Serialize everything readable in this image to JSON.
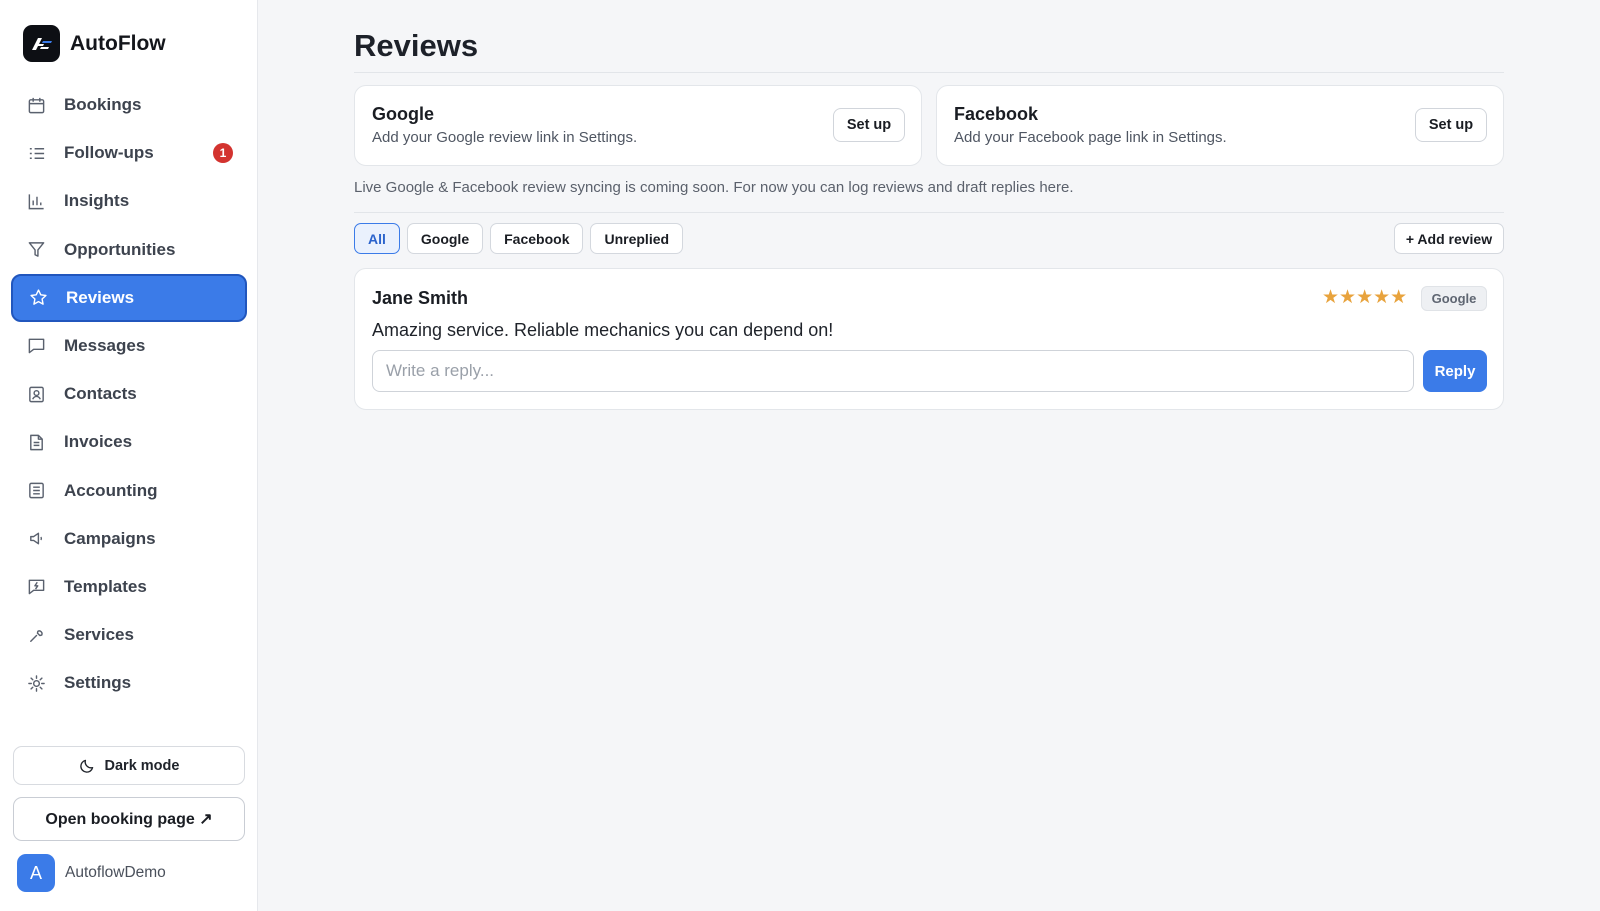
{
  "app": {
    "name": "AutoFlow",
    "logo_text": "AF"
  },
  "sidebar": {
    "items": [
      {
        "label": "Bookings",
        "icon": "calendar-icon"
      },
      {
        "label": "Follow-ups",
        "icon": "list-icon",
        "badge": "1"
      },
      {
        "label": "Insights",
        "icon": "bar-chart-icon"
      },
      {
        "label": "Opportunities",
        "icon": "filter-icon"
      },
      {
        "label": "Reviews",
        "icon": "star-icon",
        "active": true
      },
      {
        "label": "Messages",
        "icon": "message-icon"
      },
      {
        "label": "Contacts",
        "icon": "contact-icon"
      },
      {
        "label": "Invoices",
        "icon": "document-icon"
      },
      {
        "label": "Accounting",
        "icon": "ledger-icon"
      },
      {
        "label": "Campaigns",
        "icon": "megaphone-icon"
      },
      {
        "label": "Templates",
        "icon": "template-icon"
      },
      {
        "label": "Services",
        "icon": "wrench-icon"
      },
      {
        "label": "Settings",
        "icon": "gear-icon"
      }
    ],
    "dark_mode_label": "Dark mode",
    "booking_page_label": "Open booking page ↗",
    "user": {
      "initial": "A",
      "name": "AutoflowDemo"
    }
  },
  "main": {
    "title": "Reviews",
    "integrations": [
      {
        "name": "Google",
        "description": "Add your Google review link in Settings.",
        "button": "Set up"
      },
      {
        "name": "Facebook",
        "description": "Add your Facebook page link in Settings.",
        "button": "Set up"
      }
    ],
    "info": "Live Google & Facebook review syncing is coming soon. For now you can log reviews and draft replies here.",
    "filters": [
      "All",
      "Google",
      "Facebook",
      "Unreplied"
    ],
    "active_filter": "All",
    "add_review_label": "+ Add review",
    "reviews": [
      {
        "author": "Jane Smith",
        "rating": 5,
        "stars": "★★★★★",
        "source": "Google",
        "text": "Amazing service. Reliable mechanics you can depend on!",
        "reply_placeholder": "Write a reply...",
        "reply_button": "Reply"
      }
    ]
  },
  "colors": {
    "accent": "#3b7be8",
    "badge": "#d3332f",
    "star": "#e8a33d"
  }
}
